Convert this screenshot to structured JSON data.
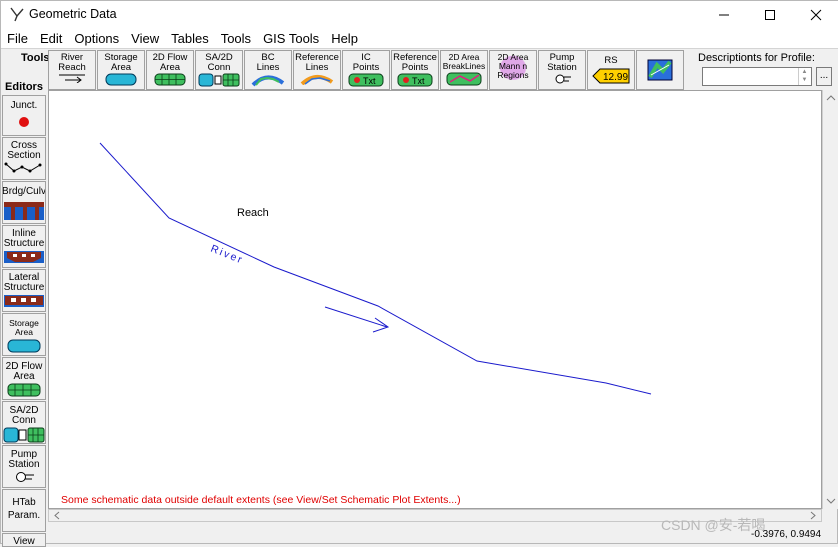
{
  "window": {
    "title": "Geometric Data",
    "minimize_icon": "minimize-icon",
    "maximize_icon": "maximize-icon",
    "close_icon": "close-icon"
  },
  "menu": [
    "File",
    "Edit",
    "Options",
    "View",
    "Tables",
    "Tools",
    "GIS Tools",
    "Help"
  ],
  "toolbar": {
    "label": "Tools",
    "buttons": [
      {
        "label": "River\nReach",
        "icon": "arrow-right-icon"
      },
      {
        "label": "Storage\nArea",
        "icon": "storage-area-icon"
      },
      {
        "label": "2D Flow\nArea",
        "icon": "flow-area-grid-icon"
      },
      {
        "label": "SA/2D\nConn",
        "icon": "sa-2d-connection-icon"
      },
      {
        "label": "BC\nLines",
        "icon": "bc-lines-icon"
      },
      {
        "label": "Reference\nLines",
        "icon": "reference-lines-icon"
      },
      {
        "label": "IC\nPoints",
        "icon": "ic-points-icon"
      },
      {
        "label": "Reference\nPoints",
        "icon": "reference-points-icon"
      },
      {
        "label": "2D Area\nBreakLines",
        "icon": "breaklines-icon"
      },
      {
        "label": "2D Area\nMann n\nRegions",
        "icon": "manning-regions-icon"
      },
      {
        "label": "Pump\nStation",
        "icon": "pump-icon"
      },
      {
        "label": "RS",
        "icon": "river-station-tag-icon",
        "value": "12.99"
      },
      {
        "label": "",
        "icon": "gis-map-icon"
      }
    ],
    "description_label": "Description",
    "description_label_overlap": "nts for Profile:",
    "description_value": "",
    "more_button": "..."
  },
  "editors": {
    "label": "Editors",
    "buttons": [
      {
        "label": "Junct.",
        "icon": "junction-icon"
      },
      {
        "label": "Cross\nSection",
        "icon": "cross-section-icon"
      },
      {
        "label": "Brdg/Culv",
        "icon": "bridge-culvert-icon"
      },
      {
        "label": "Inline\nStructure",
        "icon": "inline-structure-icon"
      },
      {
        "label": "Lateral\nStructure",
        "icon": "lateral-structure-icon"
      },
      {
        "label": "Storage\nArea",
        "icon": "storage-area-icon"
      },
      {
        "label": "2D Flow\nArea",
        "icon": "flow-area-grid-icon"
      },
      {
        "label": "SA/2D\nConn",
        "icon": "sa-2d-connection-icon"
      },
      {
        "label": "Pump\nStation",
        "icon": "pump-icon"
      },
      {
        "label": "HTab\nParam.",
        "icon": ""
      },
      {
        "label": "View",
        "icon": ""
      }
    ]
  },
  "canvas": {
    "reach_label": "Reach",
    "river_label": "River",
    "warning": "Some schematic data outside default extents (see View/Set Schematic Plot Extents...)",
    "coordinates": "-0.3976, 0.9494",
    "watermark": "CSDN @安-若喝",
    "colors": {
      "river": "#0000cc",
      "warning": "#e00000"
    }
  }
}
